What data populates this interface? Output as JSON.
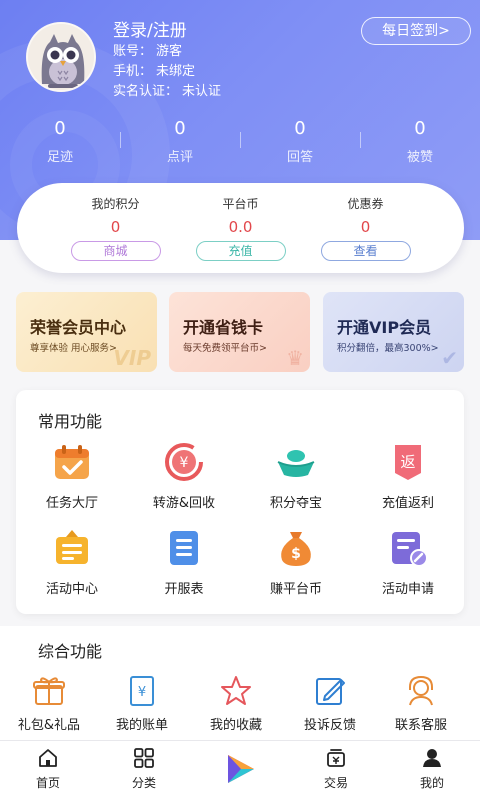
{
  "profile": {
    "title": "登录/注册",
    "account_label": "账号：",
    "account_value": "游客",
    "phone_label": "手机：",
    "phone_value": "未绑定",
    "realname_label": "实名认证：",
    "realname_value": "未认证",
    "checkin_label": "每日签到>"
  },
  "stats": [
    {
      "value": "0",
      "label": "足迹"
    },
    {
      "value": "0",
      "label": "点评"
    },
    {
      "value": "0",
      "label": "回答"
    },
    {
      "value": "0",
      "label": "被赞"
    }
  ],
  "wallet": [
    {
      "label": "我的积分",
      "value": "0",
      "button": "商城",
      "color": "#b07ad8"
    },
    {
      "label": "平台币",
      "value": "0.0",
      "button": "充值",
      "color": "#3bb6a7"
    },
    {
      "label": "优惠券",
      "value": "0",
      "button": "查看",
      "color": "#5a7fcf"
    }
  ],
  "promos": [
    {
      "title": "荣誉会员中心",
      "sub": "尊享体验 用心服务>",
      "deco": "VIP"
    },
    {
      "title": "开通省钱卡",
      "sub": "每天免费领平台币>",
      "deco": "♛"
    },
    {
      "title": "开通VIP会员",
      "sub": "积分翻倍，最高300%>",
      "deco": "✔"
    }
  ],
  "common": {
    "title": "常用功能",
    "items": [
      {
        "label": "任务大厅",
        "icon": "calendar-check-icon"
      },
      {
        "label": "转游&回收",
        "icon": "yuan-recycle-icon"
      },
      {
        "label": "积分夺宝",
        "icon": "ingot-icon"
      },
      {
        "label": "充值返利",
        "icon": "rebate-tag-icon"
      },
      {
        "label": "活动中心",
        "icon": "activity-board-icon"
      },
      {
        "label": "开服表",
        "icon": "server-list-icon"
      },
      {
        "label": "赚平台币",
        "icon": "money-bag-icon"
      },
      {
        "label": "活动申请",
        "icon": "apply-form-icon"
      }
    ]
  },
  "general": {
    "title": "综合功能",
    "items": [
      {
        "label": "礼包&礼品",
        "icon": "gift-icon"
      },
      {
        "label": "我的账单",
        "icon": "bill-icon"
      },
      {
        "label": "我的收藏",
        "icon": "star-icon"
      },
      {
        "label": "投诉反馈",
        "icon": "edit-feedback-icon"
      },
      {
        "label": "联系客服",
        "icon": "customer-service-icon"
      }
    ]
  },
  "tabs": [
    {
      "label": "首页",
      "icon": "home-icon"
    },
    {
      "label": "分类",
      "icon": "category-icon"
    },
    {
      "label": "",
      "icon": "play-logo-icon"
    },
    {
      "label": "交易",
      "icon": "trade-icon"
    },
    {
      "label": "我的",
      "icon": "user-icon"
    }
  ],
  "colors": {
    "header": "#7b8cf4",
    "accent_red": "#e2474b",
    "accent_orange": "#f5a623"
  }
}
